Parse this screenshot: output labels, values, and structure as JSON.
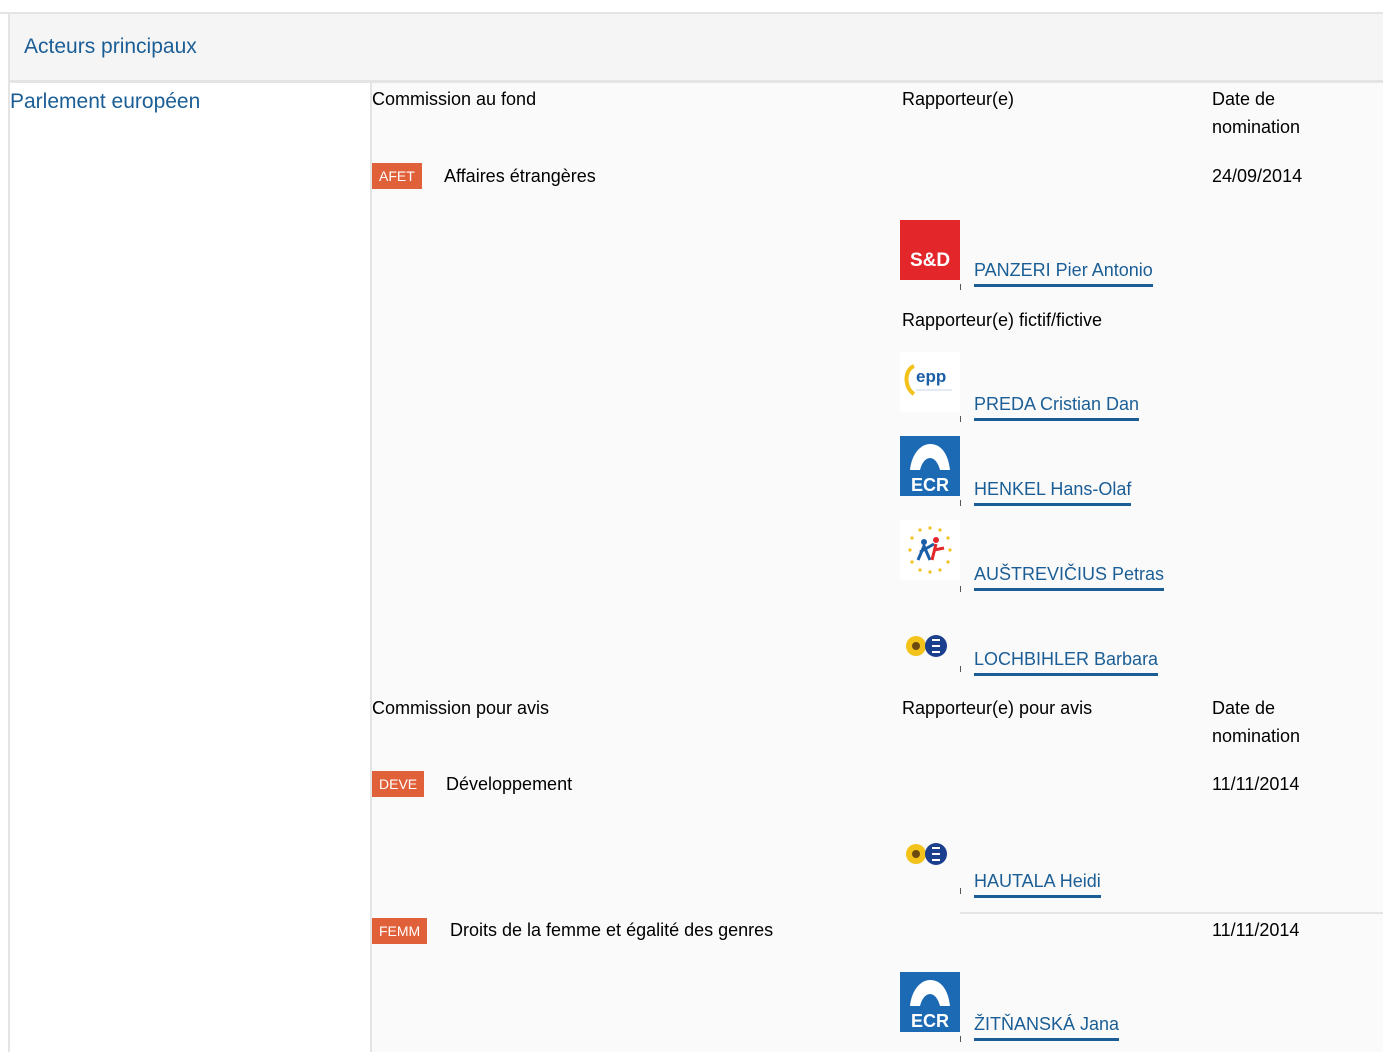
{
  "section_title": "Acteurs principaux",
  "institution": "Parlement européen",
  "lead": {
    "committee_heading": "Commission au fond",
    "rapporteur_heading": "Rapporteur(e)",
    "date_heading": "Date de nomination",
    "committee_code": "AFET",
    "committee_name": "Affaires étrangères",
    "date": "24/09/2014",
    "rapporteur": {
      "name": "PANZERI Pier Antonio",
      "group_logo": "sd-logo",
      "group_label": "S&D"
    },
    "shadow_heading": "Rapporteur(e) fictif/fictive",
    "shadows": [
      {
        "name": "PREDA Cristian Dan",
        "group_logo": "epp-logo",
        "group_label": "epp"
      },
      {
        "name": "HENKEL Hans-Olaf",
        "group_logo": "ecr-logo",
        "group_label": "ECR"
      },
      {
        "name": "AUŠTREVIČIUS Petras",
        "group_logo": "alde-logo"
      },
      {
        "name": "LOCHBIHLER Barbara",
        "group_logo": "greens-logo"
      }
    ]
  },
  "opinion": {
    "committee_heading": "Commission pour avis",
    "rapporteur_heading": "Rapporteur(e) pour avis",
    "date_heading": "Date de nomination",
    "committees": [
      {
        "code": "DEVE",
        "name": "Développement",
        "date": "11/11/2014",
        "rapporteur": {
          "name": "HAUTALA Heidi",
          "group_logo": "greens-logo"
        }
      },
      {
        "code": "FEMM",
        "name": "Droits de la femme et égalité des genres",
        "date": "11/11/2014",
        "rapporteur": {
          "name": "ŽITŇANSKÁ Jana",
          "group_logo": "ecr-logo",
          "group_label": "ECR"
        }
      }
    ]
  },
  "colors": {
    "link": "#1b5e96",
    "badge": "#e0603a",
    "sd_red": "#e3262a",
    "ecr_blue": "#1b6ab3"
  }
}
